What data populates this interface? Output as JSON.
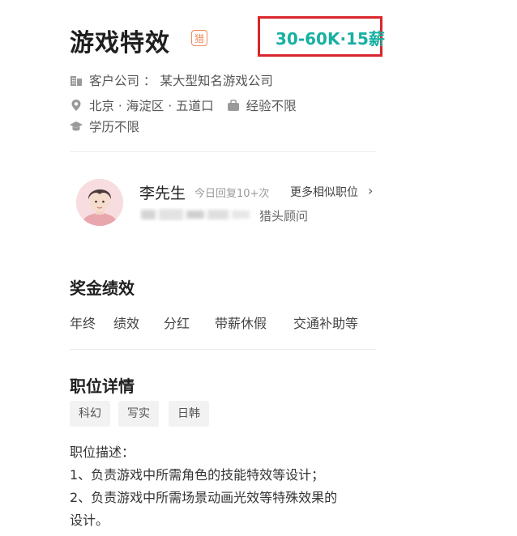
{
  "header": {
    "title": "游戏特效",
    "badge": "猎",
    "salary": "30-60K·15薪"
  },
  "meta": {
    "company_label": "客户公司 ： 某大型知名游戏公司",
    "location": "北京 · 海淀区 · 五道口",
    "experience": "经验不限",
    "education": "学历不限"
  },
  "contact": {
    "name": "李先生",
    "reply": "今日回复10+次",
    "more": "更多相似职位",
    "role": "猎头顾问"
  },
  "benefits": {
    "title": "奖金绩效",
    "items": [
      "年终",
      "绩效",
      "分红",
      "带薪休假",
      "交通补助等"
    ]
  },
  "details": {
    "title": "职位详情",
    "tags": [
      "科幻",
      "写实",
      "日韩"
    ],
    "desc_label": "职位描述：",
    "lines": [
      "1、负责游戏中所需角色的技能特效等设计；",
      "2、负责游戏中所需场景动画光效等特殊效果的",
      "设计。"
    ]
  },
  "colors": {
    "accent": "#17b0a3",
    "badge": "#f08a5d",
    "highlight_border": "#d9262c"
  }
}
